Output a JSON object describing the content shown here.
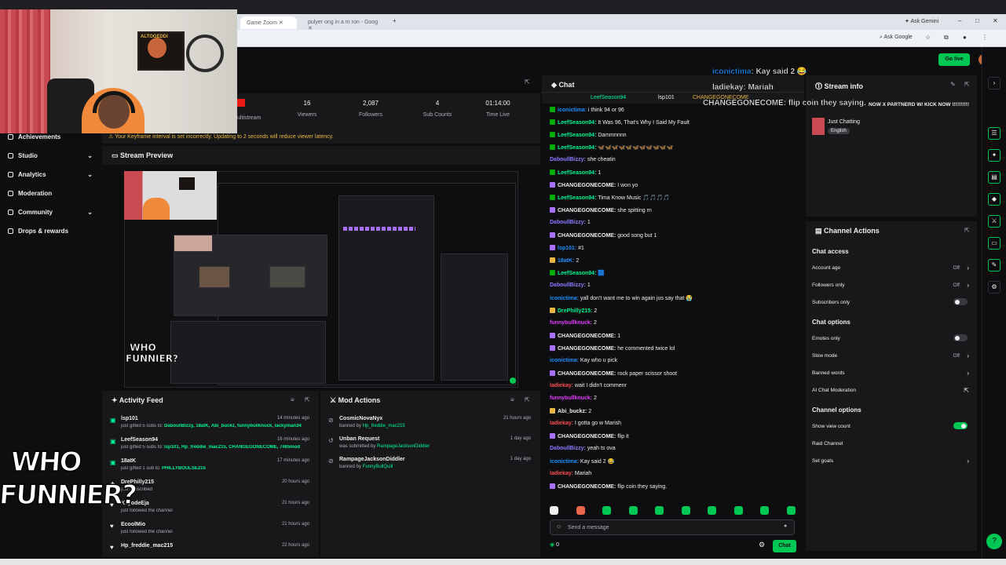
{
  "browser": {
    "tabs": [
      {
        "label": "Game Zoom",
        "active": true
      },
      {
        "label": "pulyer ong in a m ron - Goog",
        "active": false
      }
    ],
    "ask_gemini": "Ask Gemini",
    "ask_google": "Ask Google"
  },
  "webcam": {
    "poster_text": "ALTOGEDDI"
  },
  "stats": [
    {
      "value": "16",
      "label": "Viewers"
    },
    {
      "value": "2,087",
      "label": "Followers"
    },
    {
      "value": "4",
      "label": "Sub Counts"
    },
    {
      "value": "01:14:00",
      "label": "Time Live"
    }
  ],
  "stats_partial_label": "ultistream",
  "go_live": "Go live",
  "sidebar": {
    "items": [
      {
        "label": "Achievements",
        "chevron": false
      },
      {
        "label": "Studio",
        "chevron": true
      },
      {
        "label": "Analytics",
        "chevron": true
      },
      {
        "label": "Moderation",
        "chevron": false
      },
      {
        "label": "Community",
        "chevron": true
      },
      {
        "label": "Drops & rewards",
        "chevron": false
      }
    ]
  },
  "alert": "Your Keyframe interval is set incorrectly. Updating to 2 seconds will reduce viewer latency.",
  "preview": {
    "title": "Stream Preview",
    "small_logo": "WHO FUNNIER?"
  },
  "activity_feed": {
    "title": "Activity Feed",
    "rows": [
      {
        "icon": "gift",
        "name": "lsp101",
        "desc_prefix": "just gifted 5 subs to: ",
        "desc_hl": "DaboullBizzy, 18atK, Abi_buckz, funnybullknuck, lackyman34",
        "time": "14 minutes ago"
      },
      {
        "icon": "gift",
        "name": "LeefSeason94",
        "desc_prefix": "just gifted 5 subs to: ",
        "desc_hl": "lsp101, Hp_freddie_mac215, CHANGEGONECOME, 7465mod",
        "time": "16 minutes ago"
      },
      {
        "icon": "gift",
        "name": "18atK",
        "desc_prefix": "just gifted 1 sub to: ",
        "desc_hl": "PHILLYBOULSE215",
        "time": "17 minutes ago"
      },
      {
        "icon": "star",
        "name": "DrePhilly215",
        "desc_prefix": "just subscribed",
        "desc_hl": "",
        "time": "20 hours ago"
      },
      {
        "icon": "heart",
        "name": "KayodeEja",
        "desc_prefix": "just followed the channel",
        "desc_hl": "",
        "time": "21 hours ago"
      },
      {
        "icon": "heart",
        "name": "EcoolMio",
        "desc_prefix": "just followed the channel",
        "desc_hl": "",
        "time": "21 hours ago"
      },
      {
        "icon": "heart",
        "name": "Hp_freddie_mac215",
        "desc_prefix": "",
        "desc_hl": "",
        "time": "22 hours ago"
      }
    ]
  },
  "mod_actions": {
    "title": "Mod Actions",
    "rows": [
      {
        "icon": "ban",
        "name": "CosmicNovaNyx",
        "desc_prefix": "banned by ",
        "desc_hl": "Hp_freddie_mac215",
        "time": "21 hours ago"
      },
      {
        "icon": "undo",
        "name": "Unban Request",
        "desc_prefix": "was submitted by ",
        "desc_hl": "RampageJacksonDiddler",
        "time": "1 day ago"
      },
      {
        "icon": "ban",
        "name": "RampageJacksonDiddler",
        "desc_prefix": "banned by ",
        "desc_hl": "FunnyBullQuill",
        "time": "1 day ago"
      }
    ]
  },
  "logo": {
    "line1": "WHO",
    "line2": "FUNNIER?"
  },
  "chat": {
    "title": "Chat",
    "top_users": [
      "LeefSeason94",
      "lsp101",
      "CHANGEGONECOME"
    ],
    "messages": [
      {
        "user": "iconictima",
        "color": "#1e90ff",
        "badge": "#00ad03",
        "text": "i think 94 or 96"
      },
      {
        "user": "LeefSeason94",
        "color": "#00f593",
        "badge": "#00ad03",
        "text": "It Was 96, That's Why I Said My Fault"
      },
      {
        "user": "LeefSeason94",
        "color": "#00f593",
        "badge": "#00ad03",
        "text": "Dammnnnn"
      },
      {
        "user": "LeefSeason94",
        "color": "#00f593",
        "badge": "#00ad03",
        "text": "🦋🦋🦋🦋🦋🦋🦋🦋🦋🦋🦋"
      },
      {
        "user": "DaboullBizzy",
        "color": "#8a7cff",
        "badge": "",
        "text": "she cheatin"
      },
      {
        "user": "LeefSeason94",
        "color": "#00f593",
        "badge": "#00ad03",
        "text": "1"
      },
      {
        "user": "CHANGEGONECOME",
        "color": "#efeff1",
        "badge": "#a970ff",
        "text": "I won yo"
      },
      {
        "user": "LeefSeason94",
        "color": "#00f593",
        "badge": "#00ad03",
        "text": "Tima Know Music 🎵🎵🎵🎵"
      },
      {
        "user": "CHANGEGONECOME",
        "color": "#efeff1",
        "badge": "#a970ff",
        "text": "she spitting rn"
      },
      {
        "user": "DaboullBizzy",
        "color": "#8a7cff",
        "badge": "",
        "text": "1"
      },
      {
        "user": "CHANGEGONECOME",
        "color": "#efeff1",
        "badge": "#a970ff",
        "text": "good song but 1"
      },
      {
        "user": "lsp101",
        "color": "#1e90ff",
        "badge": "#a970ff",
        "text": "#1"
      },
      {
        "user": "18atK",
        "color": "#1e90ff",
        "badge": "#e7b740",
        "text": "2"
      },
      {
        "user": "LeefSeason94",
        "color": "#00f593",
        "badge": "#00ad03",
        "text": "🟦"
      },
      {
        "user": "DaboullBizzy",
        "color": "#8a7cff",
        "badge": "",
        "text": "1"
      },
      {
        "user": "iconictima",
        "color": "#1e90ff",
        "badge": "",
        "text": "yall don't want me to win again jus say that 😭"
      },
      {
        "user": "DrePhilly215",
        "color": "#00f593",
        "badge": "#e7b740",
        "text": "2"
      },
      {
        "user": "funnybullknuck",
        "color": "#e13cff",
        "badge": "",
        "text": "2"
      },
      {
        "user": "CHANGEGONECOME",
        "color": "#efeff1",
        "badge": "#a970ff",
        "text": "1"
      },
      {
        "user": "CHANGEGONECOME",
        "color": "#efeff1",
        "badge": "#a970ff",
        "text": "he commented twice lol"
      },
      {
        "user": "iconictima",
        "color": "#1e90ff",
        "badge": "",
        "text": "Kay who u pick"
      },
      {
        "user": "CHANGEGONECOME",
        "color": "#efeff1",
        "badge": "#a970ff",
        "text": "rock paper scissor shoot"
      },
      {
        "user": "ladiekay",
        "color": "#ff4f4f",
        "badge": "",
        "text": "wait I didn't commenr"
      },
      {
        "user": "funnybullknuck",
        "color": "#e13cff",
        "badge": "",
        "text": "2"
      },
      {
        "user": "Abi_buckz",
        "color": "#efeff1",
        "badge": "#e7b740",
        "text": "2"
      },
      {
        "user": "ladiekay",
        "color": "#ff4f4f",
        "badge": "",
        "text": "I gotta go w Marish"
      },
      {
        "user": "CHANGEGONECOME",
        "color": "#efeff1",
        "badge": "#a970ff",
        "text": "flip it"
      },
      {
        "user": "DaboullBizzy",
        "color": "#8a7cff",
        "badge": "",
        "text": "yeah ts ova"
      },
      {
        "user": "iconictima",
        "color": "#1e90ff",
        "badge": "",
        "text": "Kay said 2 😂"
      },
      {
        "user": "ladiekay",
        "color": "#ff4f4f",
        "badge": "",
        "text": "Mariah"
      },
      {
        "user": "CHANGEGONECOME",
        "color": "#efeff1",
        "badge": "#a970ff",
        "text": "flip coin they saying."
      }
    ],
    "input_placeholder": "Send a message",
    "send_label": "Chat",
    "points": "0"
  },
  "overlay": [
    {
      "user": "iconictima",
      "text": ": Kay said 2 😂",
      "color": "#1e90ff"
    },
    {
      "user": "ladiekay",
      "text": ": Mariah",
      "color": "#efeff1"
    },
    {
      "user": "CHANGEGONECOME",
      "text": ": flip coin they saying.",
      "color": "#efeff1"
    }
  ],
  "stream_info": {
    "title": "Stream info",
    "stream_title": "NOW X PARTNERD W/ KICK NOW !!!!!!!!!!",
    "category": "Just Chatting",
    "tag": "English"
  },
  "channel_actions": {
    "title": "Channel Actions",
    "sections": [
      {
        "heading": "Chat access",
        "rows": [
          {
            "label": "Account age",
            "value": "Off",
            "control": "chevron"
          },
          {
            "label": "Followers only",
            "value": "Off",
            "control": "chevron"
          },
          {
            "label": "Subscribers only",
            "value": "",
            "control": "toggle-off"
          }
        ]
      },
      {
        "heading": "Chat options",
        "rows": [
          {
            "label": "Emotes only",
            "value": "",
            "control": "toggle-off"
          },
          {
            "label": "Slow mode",
            "value": "Off",
            "control": "chevron"
          },
          {
            "label": "Banned words",
            "value": "",
            "control": "chevron"
          },
          {
            "label": "AI Chat Moderation",
            "value": "",
            "control": "external"
          }
        ]
      },
      {
        "heading": "Channel options",
        "rows": [
          {
            "label": "Show view count",
            "value": "",
            "control": "toggle-on"
          },
          {
            "label": "Raid Channel",
            "value": "",
            "control": "none"
          },
          {
            "label": "Set goals",
            "value": "",
            "control": "chevron"
          }
        ]
      }
    ]
  },
  "colors": {
    "accent": "#00c853",
    "panel": "#18181b",
    "bg": "#0e0e10",
    "warning": "#e7b740"
  }
}
